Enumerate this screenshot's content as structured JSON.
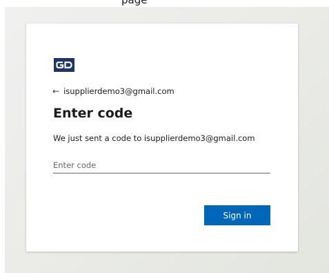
{
  "browser": {
    "tab_title": "page"
  },
  "login": {
    "logo_text": "GD",
    "back_arrow": "←",
    "email": "isupplierdemo3@gmail.com",
    "title": "Enter code",
    "description": "We just sent a code to isupplierdemo3@gmail.com",
    "code_placeholder": "Enter code",
    "code_value": "",
    "signin_label": "Sign in"
  },
  "colors": {
    "primary_button": "#0067b8",
    "logo_background": "#1f3566",
    "backdrop": "#ebece8"
  }
}
